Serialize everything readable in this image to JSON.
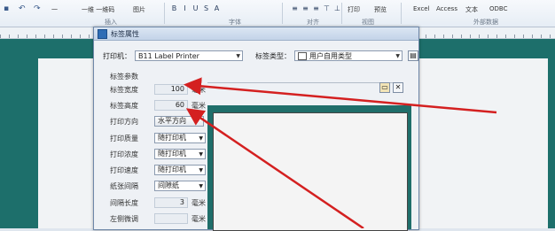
{
  "ribbon": {
    "ea_prefix": "一",
    "barcode_label": "一维 一维码",
    "image_label": "图片",
    "insert_group": "插入",
    "font_group": "字体",
    "align_group": "对齐",
    "view_group": "视图",
    "external_group": "外部数据",
    "print_label": "打印",
    "preview_label": "预览",
    "excel_label": "Excel",
    "access_label": "Access",
    "text_label": "文本",
    "odbc_label": "ODBC"
  },
  "dialog": {
    "title": "标签属性",
    "printer_label": "打印机：",
    "printer_value": "B11 Label Printer",
    "label_type_label": "标签类型：",
    "label_type_value": "用户自用类型",
    "section_title": "标签参数",
    "fields": [
      {
        "label": "标签宽度",
        "value": "100",
        "unit": "毫米"
      },
      {
        "label": "标签高度",
        "value": "60",
        "unit": "毫米"
      }
    ],
    "print_direction_label": "打印方向",
    "print_direction_value": "水平方向",
    "selects": [
      {
        "label": "打印质量",
        "value": "随打印机"
      },
      {
        "label": "打印浓度",
        "value": "随打印机"
      },
      {
        "label": "打印速度",
        "value": "随打印机"
      },
      {
        "label": "纸张间隔",
        "value": "间隙纸"
      }
    ],
    "gap_length_label": "间隔长度",
    "gap_length_value": "3",
    "gap_length_unit": "毫米",
    "left_offset_label": "左侧微调",
    "left_offset_unit": "毫米"
  },
  "colors": {
    "arrow": "#d42020",
    "workspace": "#1d6f6b"
  }
}
